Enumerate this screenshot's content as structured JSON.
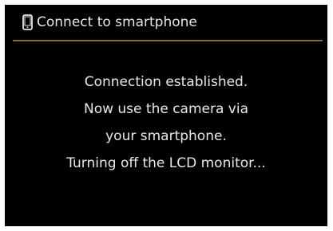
{
  "header": {
    "icon": "smartphone-icon",
    "title": "Connect to smartphone"
  },
  "message": {
    "lines": [
      "Connection established.",
      "Now use the camera via",
      "your smartphone.",
      "Turning off the LCD monitor..."
    ]
  },
  "colors": {
    "background": "#000000",
    "text": "#e8e8e8",
    "divider": "#8a6a2a"
  }
}
